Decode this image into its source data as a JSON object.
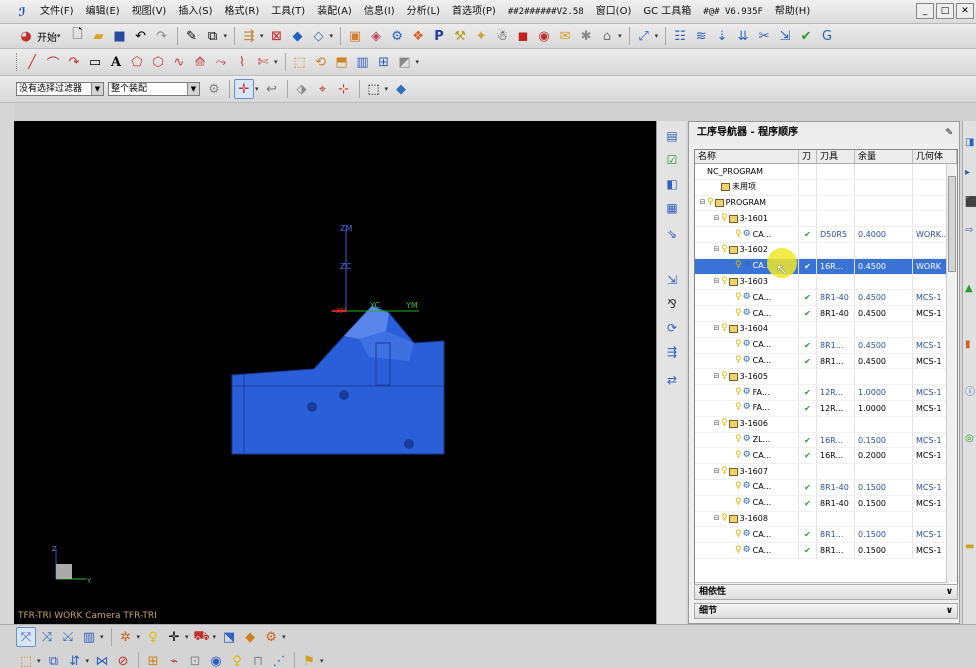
{
  "menu": {
    "logo_icon": "nx-logo-icon",
    "items": [
      "文件(F)",
      "编辑(E)",
      "视图(V)",
      "插入(S)",
      "格式(R)",
      "工具(T)",
      "装配(A)",
      "信息(I)",
      "分析(L)",
      "首选项(P)",
      "##2######V2.58",
      "窗口(O)",
      "GC 工具箱",
      "#@# V6.935F",
      "帮助(H)"
    ],
    "window_buttons": [
      "_",
      "□",
      "✕"
    ]
  },
  "toolbar1": {
    "start_label": "开始",
    "icons": [
      "new-file-icon",
      "open-folder-icon",
      "save-icon",
      "undo-icon",
      "redo-icon",
      "edit-icon",
      "copy-icon",
      "command-finder-icon",
      "fit-view-icon",
      "shaded-cube-icon",
      "wireframe-cube-icon",
      "part-navigator-icon",
      "assembly-icon",
      "operation-icon",
      "program-p-icon",
      "tool-create-icon",
      "geometry-create-icon",
      "method-icon",
      "cube-red-icon",
      "machine-icon",
      "verify-icon",
      "post-process-icon",
      "shop-doc-icon",
      "list-icon",
      "toolpath-edit-icon",
      "toolpath-gen-icon",
      "toolpath-replay-icon",
      "transform-icon",
      "check-icon"
    ]
  },
  "toolbar2": {
    "icons": [
      "line-icon",
      "arc-icon",
      "curve-icon",
      "rectangle-icon",
      "text-a-icon",
      "shape-icon",
      "sketch-icon",
      "spline-icon",
      "offset-curve-icon",
      "project-curve-icon",
      "bridge-icon",
      "trim-icon",
      "extrude-icon",
      "revolve-icon",
      "hole-icon",
      "chamfer-icon"
    ]
  },
  "toolbar3": {
    "filter_value": "没有选择过滤器",
    "scope_value": "整个装配",
    "icons": [
      "selection-icon",
      "snap-point-icon",
      "undo-select-icon",
      "view-orient-icon",
      "point-snap-icon",
      "point-add-icon",
      "box-select-icon",
      "part-cube-icon"
    ]
  },
  "viewport": {
    "camera_label": "TFR-TRI WORK Camera TFR-TRI",
    "axis_labels": {
      "zm": "ZM",
      "zc": "ZC",
      "yc": "YC",
      "ym": "YM",
      "xm": "XM",
      "z": "Z",
      "y": "Y"
    }
  },
  "navigator": {
    "title": "工序导航器 - 程序顺序",
    "columns": [
      "名称",
      "刀",
      "刀具",
      "余量",
      "几何体"
    ],
    "rows": [
      {
        "level": 0,
        "expander": "",
        "kind": "text",
        "name": "NC_PROGRAM",
        "check": "",
        "tool": "",
        "stock": "",
        "geom": "",
        "selected": false,
        "black": false
      },
      {
        "level": 1,
        "expander": "",
        "kind": "folder",
        "name": "未用项",
        "check": "",
        "tool": "",
        "stock": "",
        "geom": "",
        "selected": false,
        "black": false
      },
      {
        "level": 0,
        "expander": "⊟",
        "kind": "program",
        "name": "PROGRAM",
        "check": "",
        "tool": "",
        "stock": "",
        "geom": "",
        "selected": false,
        "black": false
      },
      {
        "level": 1,
        "expander": "⊟",
        "kind": "program",
        "name": "3-1601",
        "check": "",
        "tool": "",
        "stock": "",
        "geom": "",
        "selected": false,
        "black": false
      },
      {
        "level": 2,
        "expander": "",
        "kind": "op",
        "name": "CA...",
        "check": "✔",
        "tool": "D50R5",
        "stock": "0.4000",
        "geom": "WORK...",
        "selected": false,
        "black": false
      },
      {
        "level": 1,
        "expander": "⊟",
        "kind": "program",
        "name": "3-1602",
        "check": "",
        "tool": "",
        "stock": "",
        "geom": "",
        "selected": false,
        "black": false
      },
      {
        "level": 2,
        "expander": "",
        "kind": "op",
        "name": "CA...",
        "check": "✔",
        "tool": "16R...",
        "stock": "0.4500",
        "geom": "WORK",
        "selected": true,
        "black": false
      },
      {
        "level": 1,
        "expander": "⊟",
        "kind": "program",
        "name": "3-1603",
        "check": "",
        "tool": "",
        "stock": "",
        "geom": "",
        "selected": false,
        "black": false
      },
      {
        "level": 2,
        "expander": "",
        "kind": "op",
        "name": "CA...",
        "check": "✔",
        "tool": "8R1-40",
        "stock": "0.4500",
        "geom": "MCS-1",
        "selected": false,
        "black": false
      },
      {
        "level": 2,
        "expander": "",
        "kind": "op",
        "name": "CA...",
        "check": "✔",
        "tool": "8R1-40",
        "stock": "0.4500",
        "geom": "MCS-1",
        "selected": false,
        "black": true
      },
      {
        "level": 1,
        "expander": "⊟",
        "kind": "program",
        "name": "3-1604",
        "check": "",
        "tool": "",
        "stock": "",
        "geom": "",
        "selected": false,
        "black": false
      },
      {
        "level": 2,
        "expander": "",
        "kind": "op",
        "name": "CA...",
        "check": "✔",
        "tool": "8R1...",
        "stock": "0.4500",
        "geom": "MCS-1",
        "selected": false,
        "black": false
      },
      {
        "level": 2,
        "expander": "",
        "kind": "op",
        "name": "CA...",
        "check": "✔",
        "tool": "8R1...",
        "stock": "0.4500",
        "geom": "MCS-1",
        "selected": false,
        "black": true
      },
      {
        "level": 1,
        "expander": "⊟",
        "kind": "program",
        "name": "3-1605",
        "check": "",
        "tool": "",
        "stock": "",
        "geom": "",
        "selected": false,
        "black": false
      },
      {
        "level": 2,
        "expander": "",
        "kind": "op",
        "name": "FA...",
        "check": "✔",
        "tool": "12R...",
        "stock": "1.0000",
        "geom": "MCS-1",
        "selected": false,
        "black": false
      },
      {
        "level": 2,
        "expander": "",
        "kind": "op",
        "name": "FA...",
        "check": "✔",
        "tool": "12R...",
        "stock": "1.0000",
        "geom": "MCS-1",
        "selected": false,
        "black": true
      },
      {
        "level": 1,
        "expander": "⊟",
        "kind": "program",
        "name": "3-1606",
        "check": "",
        "tool": "",
        "stock": "",
        "geom": "",
        "selected": false,
        "black": false
      },
      {
        "level": 2,
        "expander": "",
        "kind": "op",
        "name": "ZL...",
        "check": "✔",
        "tool": "16R...",
        "stock": "0.1500",
        "geom": "MCS-1",
        "selected": false,
        "black": false
      },
      {
        "level": 2,
        "expander": "",
        "kind": "op",
        "name": "CA...",
        "check": "✔",
        "tool": "16R...",
        "stock": "0.2000",
        "geom": "MCS-1",
        "selected": false,
        "black": true
      },
      {
        "level": 1,
        "expander": "⊟",
        "kind": "program",
        "name": "3-1607",
        "check": "",
        "tool": "",
        "stock": "",
        "geom": "",
        "selected": false,
        "black": false
      },
      {
        "level": 2,
        "expander": "",
        "kind": "op",
        "name": "CA...",
        "check": "✔",
        "tool": "8R1-40",
        "stock": "0.1500",
        "geom": "MCS-1",
        "selected": false,
        "black": false
      },
      {
        "level": 2,
        "expander": "",
        "kind": "op",
        "name": "CA...",
        "check": "✔",
        "tool": "8R1-40",
        "stock": "0.1500",
        "geom": "MCS-1",
        "selected": false,
        "black": true
      },
      {
        "level": 1,
        "expander": "⊟",
        "kind": "program",
        "name": "3-1608",
        "check": "",
        "tool": "",
        "stock": "",
        "geom": "",
        "selected": false,
        "black": false
      },
      {
        "level": 2,
        "expander": "",
        "kind": "op",
        "name": "CA...",
        "check": "✔",
        "tool": "8R1...",
        "stock": "0.1500",
        "geom": "MCS-1",
        "selected": false,
        "black": false
      },
      {
        "level": 2,
        "expander": "",
        "kind": "op",
        "name": "CA...",
        "check": "✔",
        "tool": "8R1...",
        "stock": "0.1500",
        "geom": "MCS-1",
        "selected": false,
        "black": true
      }
    ],
    "sections": [
      "相依性",
      "细节"
    ]
  },
  "side_icons": [
    "operation-nav-icon",
    "machine-tool-view-icon",
    "geometry-view-icon",
    "method-view-icon",
    "program-order-icon",
    "tool-icon",
    "roles-icon",
    "history-icon",
    "palette-icon",
    "info-icon"
  ],
  "colors": {
    "viewport_bg": "#000000",
    "part": "#2b5fd9",
    "selection": "#3a73d6",
    "check": "#2a9a2a"
  }
}
